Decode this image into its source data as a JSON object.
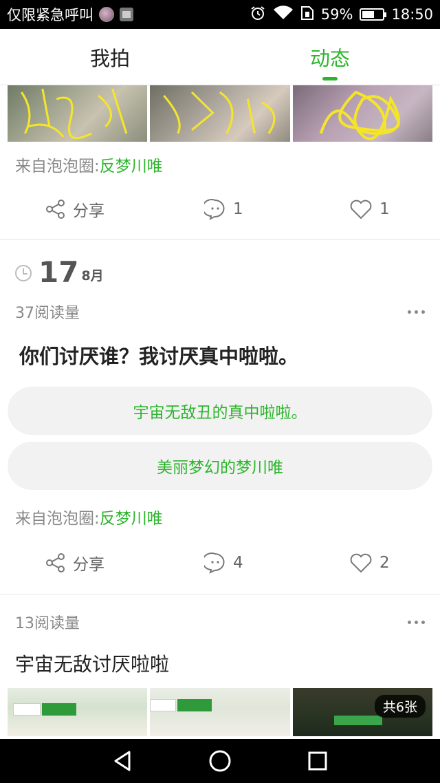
{
  "status_bar": {
    "carrier_text": "仅限紧急呼叫",
    "battery_percent_text": "59%",
    "battery_level": 0.59,
    "time": "18:50"
  },
  "tabs": [
    {
      "label": "我拍",
      "active": false
    },
    {
      "label": "动态",
      "active": true
    }
  ],
  "colors": {
    "accent": "#2db52d",
    "text_primary": "#222222",
    "text_secondary": "#888888",
    "option_bg": "#f2f2f2"
  },
  "post1": {
    "source_prefix": "来自泡泡圈:",
    "source_circle": "反梦川唯",
    "share_label": "分享",
    "comment_count": "1",
    "like_count": "1"
  },
  "date_header": {
    "day": "17",
    "month": "8月"
  },
  "post2": {
    "read_count": "37阅读量",
    "question": "你们讨厌谁？我讨厌真中啦啦。",
    "options": [
      "宇宙无敌丑的真中啦啦。",
      "美丽梦幻的梦川唯"
    ],
    "source_prefix": "来自泡泡圈:",
    "source_circle": "反梦川唯",
    "share_label": "分享",
    "comment_count": "4",
    "like_count": "2"
  },
  "post3": {
    "read_count": "13阅读量",
    "title": "宇宙无敌讨厌啦啦",
    "image_count_badge": "共6张"
  },
  "icons": {
    "share": "share-icon",
    "comment": "comment-icon",
    "like": "heart-icon",
    "clock": "clock-icon",
    "more": "more-icon"
  }
}
